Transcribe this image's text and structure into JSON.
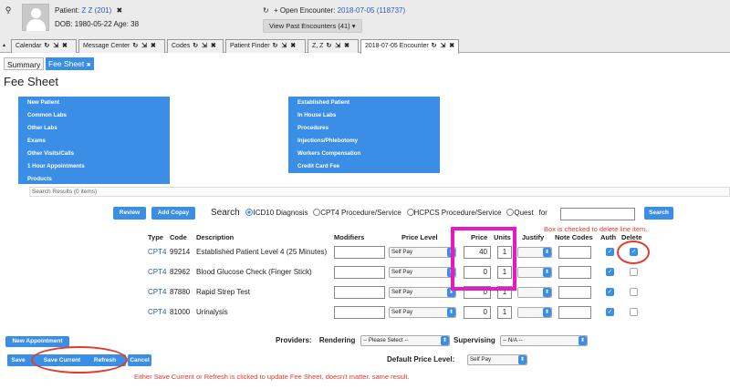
{
  "header": {
    "search_icon": "⚲",
    "patient_label": "Patient:",
    "patient_name": "Z Z (201)",
    "patient_close": "✖",
    "dob_line": "DOB: 1980-05-22 Age: 38",
    "refresh_icon": "↻",
    "add_icon": "+",
    "open_encounter_label": "Open Encounter:",
    "open_encounter_value": "2018-07-05 (118737)",
    "view_past": "View Past Encounters (41) ▾"
  },
  "tabs": [
    {
      "label": "Calendar",
      "icons": "↻ ⇲ ✖"
    },
    {
      "label": "Message Center",
      "icons": "↻ ⇲ ✖"
    },
    {
      "label": "Codes",
      "icons": "↻ ⇲ ✖"
    },
    {
      "label": "Patient Finder",
      "icons": "↻ ⇲ ✖"
    },
    {
      "label": "Z, Z",
      "icons": "↻ ⇲ ✖"
    },
    {
      "label": "2018-07-05 Encounter",
      "icons": "↻ ⇲ ✖"
    }
  ],
  "tab_collapse": "▴",
  "subtabs": {
    "summary": "Summary",
    "fee_sheet": "Fee Sheet",
    "fee_sheet_close": "✖"
  },
  "page_title": "Fee Sheet",
  "categories_left": [
    "New Patient",
    "Common Labs",
    "Other Labs",
    "Exams",
    "Other Visits/Calls",
    "1 Hour Appointments",
    "Products"
  ],
  "categories_right": [
    "Established Patient",
    "In House Labs",
    "Procedures",
    "Injections/Phlebotomy",
    "Workers Compensation",
    "Credit Card Fee"
  ],
  "search_results": "Search Results (0 items)",
  "search_bar": {
    "review": "Review",
    "add_copay": "Add Copay",
    "search_label": "Search",
    "options": [
      "ICD10 Diagnosis",
      "CPT4 Procedure/Service",
      "HCPCS Procedure/Service",
      "Quest"
    ],
    "for_label": "for",
    "search_button": "Search"
  },
  "table": {
    "headers": {
      "type": "Type",
      "code": "Code",
      "description": "Description",
      "modifiers": "Modifiers",
      "price_level": "Price Level",
      "price": "Price",
      "units": "Units",
      "justify": "Justify",
      "note_codes": "Note Codes",
      "auth": "Auth",
      "delete": "Delete"
    },
    "rows": [
      {
        "type": "CPT4",
        "code": "99214",
        "description": "Established Patient Level 4 (25 Minutes)",
        "price_level": "Self Pay",
        "price": "40",
        "units": "1",
        "delete_checked": true
      },
      {
        "type": "CPT4",
        "code": "82962",
        "description": "Blood Glucose Check (Finger Stick)",
        "price_level": "Self Pay",
        "price": "0",
        "units": "1",
        "delete_checked": false
      },
      {
        "type": "CPT4",
        "code": "87880",
        "description": "Rapid Strep Test",
        "price_level": "Self Pay",
        "price": "0",
        "units": "1",
        "delete_checked": false
      },
      {
        "type": "CPT4",
        "code": "81000",
        "description": "Urinalysis",
        "price_level": "Self Pay",
        "price": "0",
        "units": "1",
        "delete_checked": false
      }
    ]
  },
  "annotation_delete": "Box is checked to delete line item.",
  "annotation_save": "Either Save Current or Refresh is clicked to update Fee Sheet, doesn't matter. same result.",
  "bottom": {
    "new_appointment": "New Appointment",
    "providers_label": "Providers:",
    "rendering_label": "Rendering",
    "rendering_value": "-- Please Select --",
    "supervising_label": "Supervising",
    "supervising_value": "-- N/A --",
    "default_price_label": "Default Price Level:",
    "default_price_value": "Self Pay",
    "save": "Save",
    "save_current": "Save Current",
    "refresh": "Refresh",
    "cancel": "Cancel"
  },
  "colors": {
    "accent": "#3a8ee6",
    "highlight_magenta": "#e619c3",
    "annotation_red": "#e53b2c"
  }
}
